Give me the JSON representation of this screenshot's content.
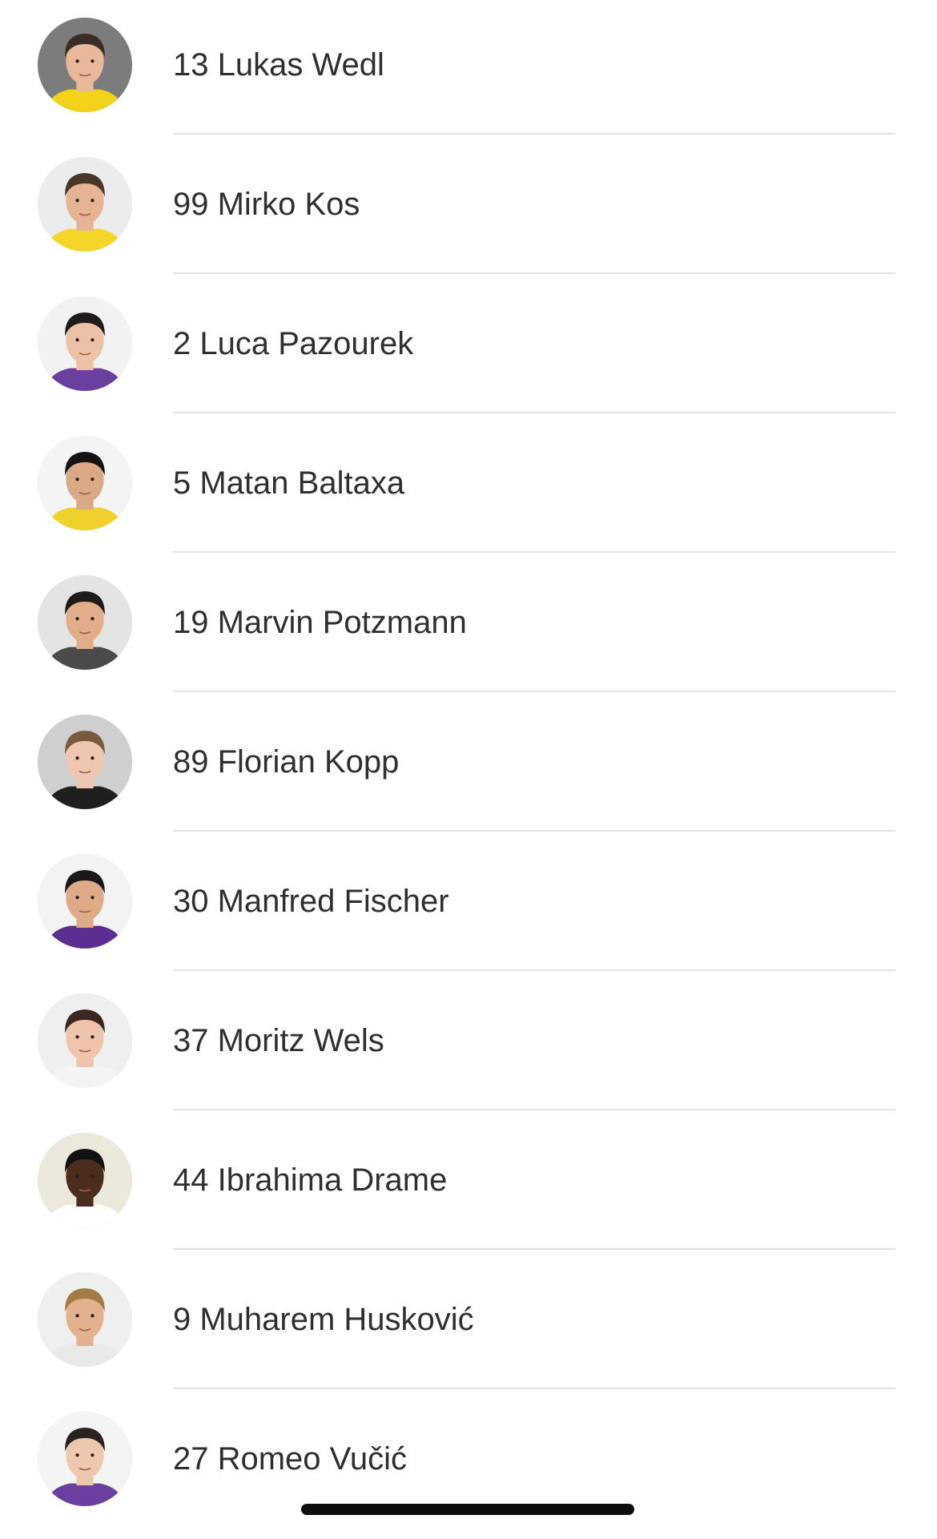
{
  "players": [
    {
      "label": "13 Lukas Wedl",
      "skin": "#e8b89a",
      "hair": "#3a2e24",
      "shirt": "#f2d21b",
      "bg": "#7c7c7c"
    },
    {
      "label": "99 Mirko Kos",
      "skin": "#e6b393",
      "hair": "#4a3526",
      "shirt": "#f4d52a",
      "bg": "#ececec"
    },
    {
      "label": "2 Luca Pazourek",
      "skin": "#edc1a6",
      "hair": "#1f1b1a",
      "shirt": "#6b3fa0",
      "bg": "#f2f2f2"
    },
    {
      "label": "5 Matan Baltaxa",
      "skin": "#dba986",
      "hair": "#151211",
      "shirt": "#f0d02a",
      "bg": "#f4f4f4"
    },
    {
      "label": "19 Marvin Potzmann",
      "skin": "#e3ad8c",
      "hair": "#1d1a18",
      "shirt": "#4a4a4a",
      "bg": "#e4e4e4"
    },
    {
      "label": "89 Florian Kopp",
      "skin": "#efc6b1",
      "hair": "#7a5a3e",
      "shirt": "#1f1f1f",
      "bg": "#cfcfcf"
    },
    {
      "label": "30 Manfred Fischer",
      "skin": "#deaa88",
      "hair": "#1b1716",
      "shirt": "#5a2f91",
      "bg": "#f3f3f3"
    },
    {
      "label": "37 Moritz Wels",
      "skin": "#efc4aa",
      "hair": "#3a281e",
      "shirt": "#f4f4f4",
      "bg": "#efefef"
    },
    {
      "label": "44 Ibrahima Drame",
      "skin": "#4a2d1d",
      "hair": "#121010",
      "shirt": "#ffffff",
      "bg": "#ece9dc"
    },
    {
      "label": "9 Muharem Husković",
      "skin": "#e4b18f",
      "hair": "#a47a44",
      "shirt": "#e9e9e9",
      "bg": "#efefef"
    },
    {
      "label": "27 Romeo Vučić",
      "skin": "#efc7ae",
      "hair": "#2a2220",
      "shirt": "#6b3fa0",
      "bg": "#f4f4f4"
    }
  ],
  "colors": {
    "text": "#2f2f2f",
    "divider": "#e3e3e3",
    "home_indicator": "#0d0d0d"
  }
}
